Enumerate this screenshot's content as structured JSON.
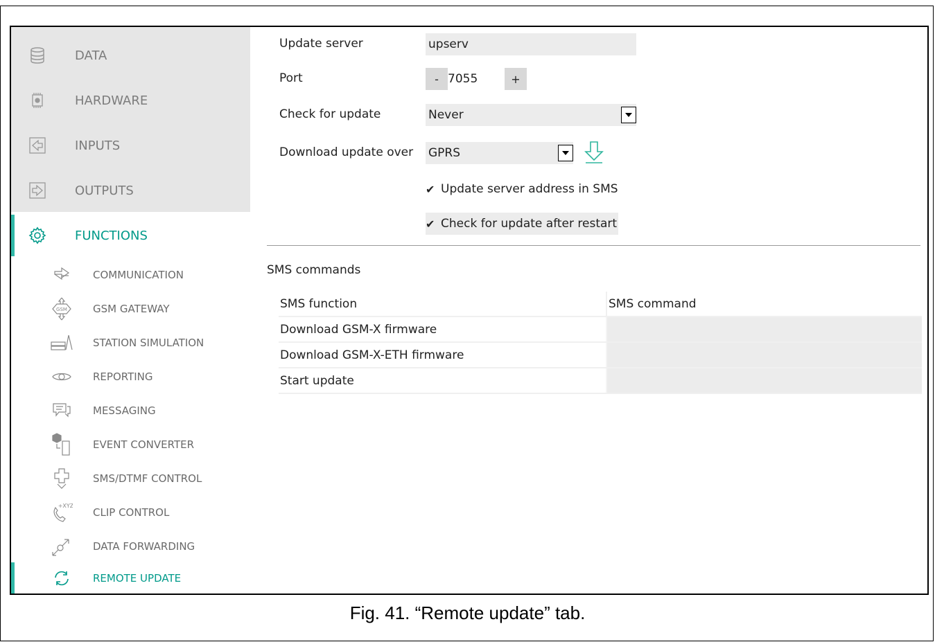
{
  "sidebar": {
    "main_items": [
      {
        "label": "DATA",
        "icon": "database-icon"
      },
      {
        "label": "HARDWARE",
        "icon": "chip-icon"
      },
      {
        "label": "INPUTS",
        "icon": "input-icon"
      },
      {
        "label": "OUTPUTS",
        "icon": "output-icon"
      },
      {
        "label": "FUNCTIONS",
        "icon": "gear-icon"
      }
    ],
    "sub_items": [
      {
        "label": "COMMUNICATION",
        "icon": "communication-icon"
      },
      {
        "label": "GSM GATEWAY",
        "icon": "gsm-gateway-icon"
      },
      {
        "label": "STATION SIMULATION",
        "icon": "station-simulation-icon"
      },
      {
        "label": "REPORTING",
        "icon": "eye-icon"
      },
      {
        "label": "MESSAGING",
        "icon": "messaging-icon"
      },
      {
        "label": "EVENT CONVERTER",
        "icon": "event-converter-icon"
      },
      {
        "label": "SMS/DTMF CONTROL",
        "icon": "sms-dtmf-icon"
      },
      {
        "label": "CLIP CONTROL",
        "icon": "clip-control-icon"
      },
      {
        "label": "DATA FORWARDING",
        "icon": "data-forwarding-icon"
      },
      {
        "label": "REMOTE UPDATE",
        "icon": "remote-update-icon"
      }
    ]
  },
  "form": {
    "update_server_label": "Update server",
    "update_server_value": "upserv",
    "port_label": "Port",
    "port_value": "7055",
    "port_minus": "-",
    "port_plus": "+",
    "check_label": "Check for update",
    "check_value": "Never",
    "download_label": "Download update over",
    "download_value": "GPRS",
    "checkbox1_label": "Update server address in SMS",
    "checkbox2_label": "Check for update after restart"
  },
  "sms": {
    "title": "SMS commands",
    "headers": [
      "SMS function",
      "SMS command"
    ],
    "rows": [
      {
        "function": "Download GSM-X firmware",
        "command": ""
      },
      {
        "function": "Download GSM-X-ETH firmware",
        "command": ""
      },
      {
        "function": "Start update",
        "command": ""
      }
    ]
  },
  "caption": "Fig. 41. “Remote update” tab.",
  "colors": {
    "accent": "#009a8a",
    "sidebar_bg": "#e6e6e6"
  }
}
